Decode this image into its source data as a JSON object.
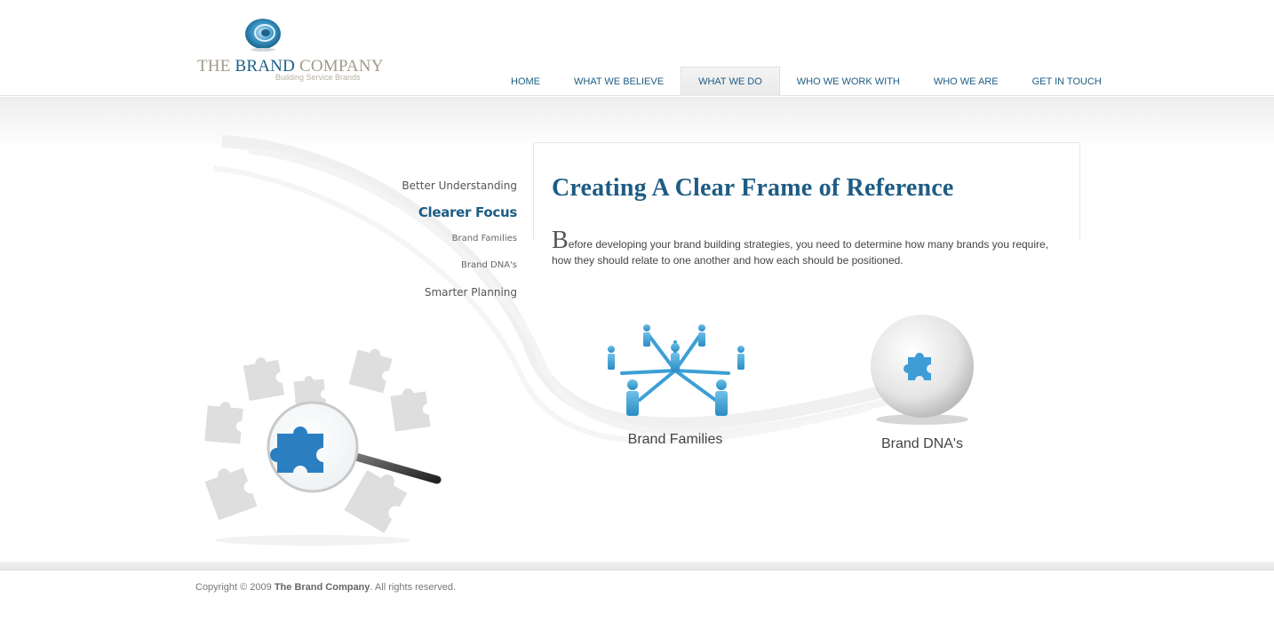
{
  "logo": {
    "word1": "THE",
    "word2": "BRAND",
    "word3": "COMPANY",
    "tagline": "Building Service Brands"
  },
  "nav": [
    {
      "label": "HOME"
    },
    {
      "label": "WHAT WE BELIEVE"
    },
    {
      "label": "WHAT WE DO",
      "active": true
    },
    {
      "label": "WHO WE WORK WITH"
    },
    {
      "label": "WHO WE ARE"
    },
    {
      "label": "GET IN TOUCH"
    }
  ],
  "sidenav": {
    "better_understanding": "Better Understanding",
    "clearer_focus": "Clearer Focus",
    "brand_families": "Brand Families",
    "brand_dna": "Brand DNA's",
    "smarter_planning": "Smarter Planning"
  },
  "main": {
    "title": "Creating A Clear Frame of Reference",
    "dropcap": "B",
    "intro": "efore developing your brand building strategies, you need to determine how many brands you require, how they should relate to one another and how each should be positioned."
  },
  "features": [
    {
      "label": "Brand Families",
      "icon": "people-network-icon"
    },
    {
      "label": "Brand DNA's",
      "icon": "puzzle-sphere-icon"
    }
  ],
  "footer": {
    "prefix": "Copyright © 2009 ",
    "company": "The Brand Company",
    "suffix": ". All rights reserved."
  },
  "colors": {
    "brand_blue": "#1e5c84",
    "accent_blue": "#3a8fc9",
    "logo_grey": "#a19a88"
  }
}
